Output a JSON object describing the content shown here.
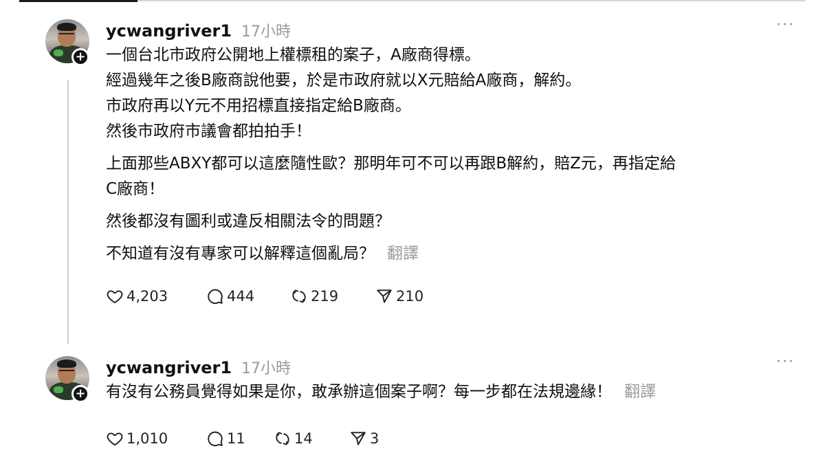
{
  "posts": [
    {
      "username": "ycwangriver1",
      "time": "17小時",
      "more": "···",
      "paragraphs": [
        "一個台北市政府公開地上權標租的案子，A廠商得標。\n經過幾年之後B廠商說他要，於是市政府就以X元賠給A廠商，解約。\n市政府再以Y元不用招標直接指定給B廠商。\n然後市政府市議會都拍拍手！",
        "上面那些ABXY都可以這麼隨性歐？那明年可不可以再跟B解約，賠Z元，再指定給\nC廠商！",
        "然後都沒有圖利或違反相關法令的問題？",
        "不知道有沒有專家可以解釋這個亂局？"
      ],
      "translate": "翻譯",
      "likes": "4,203",
      "comments": "444",
      "reposts": "219",
      "shares": "210"
    },
    {
      "username": "ycwangriver1",
      "time": "17小時",
      "more": "···",
      "text": "有沒有公務員覺得如果是你，敢承辦這個案子啊？每一步都在法規邊緣！",
      "translate": "翻譯",
      "likes": "1,010",
      "comments": "11",
      "reposts": "14",
      "shares": "3"
    }
  ]
}
